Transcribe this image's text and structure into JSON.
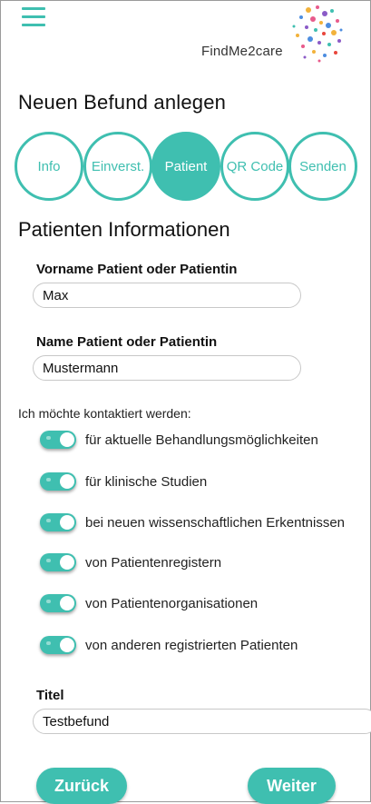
{
  "header": {
    "menu_icon": "hamburger-icon",
    "logo_text": "FindMe2care"
  },
  "page_title": "Neuen Befund anlegen",
  "steps": [
    {
      "label": "Info",
      "active": false
    },
    {
      "label": "Einverst.",
      "active": false
    },
    {
      "label": "Patient",
      "active": true
    },
    {
      "label": "QR Code",
      "active": false
    },
    {
      "label": "Senden",
      "active": false
    }
  ],
  "section_title": "Patienten Informationen",
  "fields": {
    "firstname": {
      "label": "Vorname Patient oder Patientin",
      "value": "Max"
    },
    "lastname": {
      "label": "Name Patient oder Patientin",
      "value": "Mustermann"
    },
    "title": {
      "label": "Titel",
      "value": "Testbefund"
    }
  },
  "contact": {
    "label": "Ich möchte kontaktiert werden:",
    "options": [
      {
        "label": "für aktuelle Behandlungsmöglichkeiten",
        "checked": true
      },
      {
        "label": "für klinische Studien",
        "checked": true
      },
      {
        "label": "bei neuen wissenschaftlichen Erkentnissen",
        "checked": true
      },
      {
        "label": "von Patientenregistern",
        "checked": true
      },
      {
        "label": "von Patientenorganisationen",
        "checked": true
      },
      {
        "label": "von anderen registrierten Patienten",
        "checked": true
      }
    ]
  },
  "buttons": {
    "back": "Zurück",
    "next": "Weiter"
  },
  "colors": {
    "accent": "#3fbfb0"
  }
}
